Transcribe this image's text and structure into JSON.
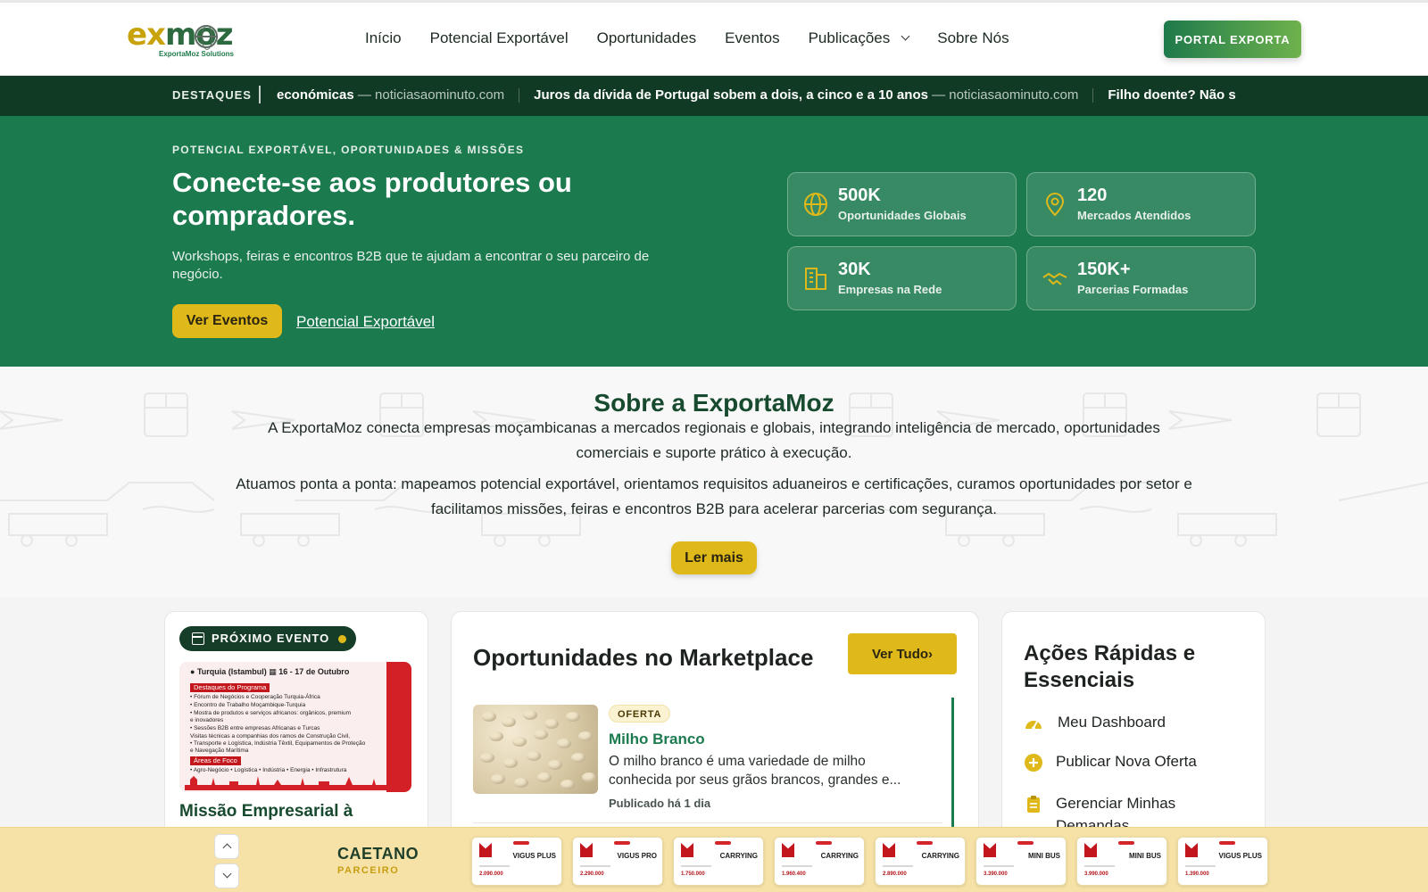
{
  "brand": {
    "logo_part1": "ex",
    "logo_part2": "moz",
    "logo_sub": "ExportaMoz Solutions",
    "accent": "#1c7a4f",
    "gold": "#dfb91a"
  },
  "nav": {
    "items": [
      "Início",
      "Potencial Exportável",
      "Oportunidades",
      "Eventos",
      "Publicações",
      "Sobre Nós"
    ],
    "portal_button": "PORTAL EXPORTA"
  },
  "ticker": {
    "label": "DESTAQUES",
    "items": [
      {
        "headline": "económicas",
        "source": "— noticiasaominuto.com"
      },
      {
        "headline": "Juros da dívida de Portugal sobem a dois, a cinco e a 10 anos",
        "source": "— noticiasaominuto.com"
      },
      {
        "headline": "Filho doente? Não s",
        "source": ""
      }
    ]
  },
  "hero": {
    "eyebrow": "POTENCIAL EXPORTÁVEL, OPORTUNIDADES & MISSÕES",
    "title": "Conecte-se aos produtores ou compradores.",
    "description": "Workshops, feiras e encontros B2B que te ajudam a encontrar o seu parceiro de negócio.",
    "primary_button": "Ver Eventos",
    "secondary_link": "Potencial Exportável",
    "stats": [
      {
        "value": "500K",
        "label": "Oportunidades Globais",
        "icon": "globe-icon"
      },
      {
        "value": "120",
        "label": "Mercados Atendidos",
        "icon": "map-pin-icon"
      },
      {
        "value": "30K",
        "label": "Empresas na Rede",
        "icon": "building-icon"
      },
      {
        "value": "150K+",
        "label": "Parcerias Formadas",
        "icon": "handshake-icon"
      }
    ]
  },
  "about": {
    "title": "Sobre a ExportaMoz",
    "paragraph1": "A ExportaMoz conecta empresas moçambicanas a mercados regionais e globais, integrando inteligência de mercado, oportunidades comerciais e suporte prático à execução.",
    "paragraph2": "Atuamos ponta a ponta: mapeamos potencial exportável, orientamos requisitos aduaneiros e certificações, curamos oportunidades por setor e facilitamos missões, feiras e encontros B2B para acelerar parcerias com segurança.",
    "button": "Ler mais"
  },
  "event_card": {
    "badge": "PRÓXIMO EVENTO",
    "poster": {
      "location": "Turquia (Istambul)",
      "dates": "16 - 17 de Outubro",
      "highlights_head": "Destaques do Programa",
      "lines": [
        "• Fórum de Negócios e Cooperação Turquia-África",
        "• Encontro de Trabalho Moçambique-Turquia",
        "• Mostra de produtos e serviços africanos: orgânicos, premium",
        "  e inovadores",
        "• Sessões B2B entre empresas Africanas e Turcas",
        "  Visitas técnicas a companhias dos ramos de Construção Civil,",
        "• Transporte e Logística, Indústria Têxtil, Equipamentos de Proteção",
        "  e Navegação Marítima"
      ],
      "focus_head": "Áreas de Foco",
      "focus_line": "• Agro-Negócio   • Logística   • Indústria   • Energia   • Infrastrutura"
    },
    "title": "Missão Empresarial à"
  },
  "marketplace": {
    "title": "Oportunidades no Marketplace",
    "view_all": "Ver Tudo",
    "offer": {
      "badge": "OFERTA",
      "title": "Milho Branco",
      "description": "O milho branco é uma variedade de milho conhecida por seus grãos brancos, grandes e...",
      "published": "Publicado há 1 dia"
    }
  },
  "quick_actions": {
    "title": "Ações Rápidas e Essenciais",
    "items": [
      {
        "label": "Meu Dashboard",
        "icon": "dashboard-gauge-icon"
      },
      {
        "label": "Publicar Nova Oferta",
        "icon": "plus-circle-icon"
      },
      {
        "label": "Gerenciar Minhas Demandas",
        "icon": "clipboard-icon"
      }
    ]
  },
  "partner_bar": {
    "name": "CAETANO",
    "role": "PARCEIRO",
    "thumbnails": [
      {
        "model": "VIGUS PLUS",
        "price": "2.090.000"
      },
      {
        "model": "VIGUS PRO",
        "price": "2.290.000"
      },
      {
        "model": "CARRYING",
        "price": "1.750.000"
      },
      {
        "model": "CARRYING",
        "price": "1.960.400"
      },
      {
        "model": "CARRYING",
        "price": "2.890.000"
      },
      {
        "model": "MINI BUS",
        "price": "3.390.000"
      },
      {
        "model": "MINI BUS",
        "price": "3.990.000"
      },
      {
        "model": "VIGUS PLUS",
        "price": "1.390.000"
      }
    ]
  }
}
